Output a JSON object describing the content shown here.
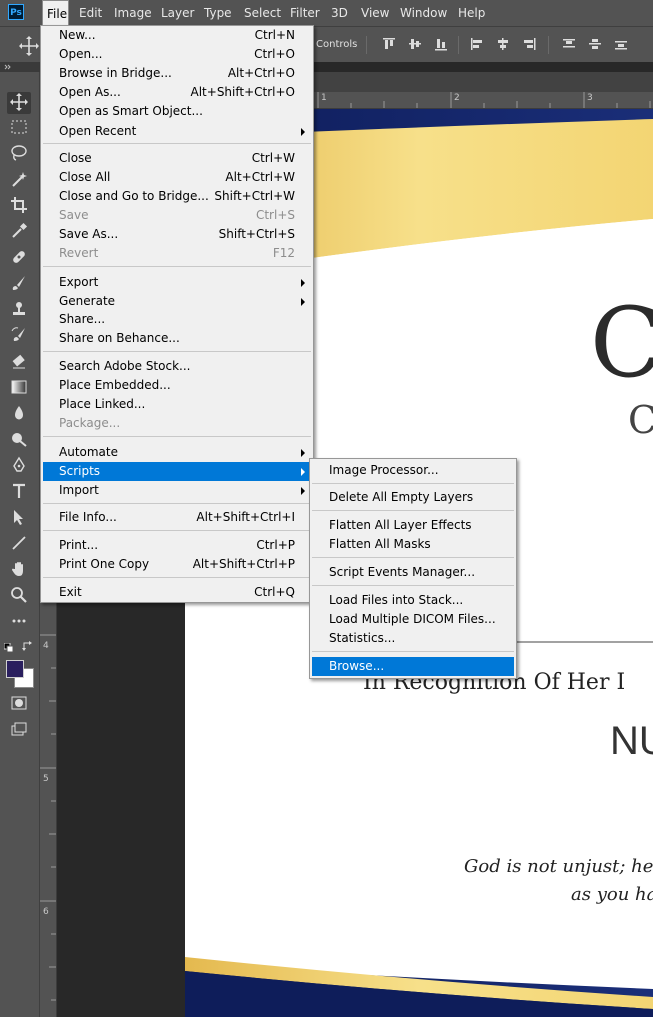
{
  "app": {
    "logo_text": "Ps"
  },
  "menubar": {
    "items": [
      {
        "label": "File"
      },
      {
        "label": "Edit"
      },
      {
        "label": "Image"
      },
      {
        "label": "Layer"
      },
      {
        "label": "Type"
      },
      {
        "label": "Select"
      },
      {
        "label": "Filter"
      },
      {
        "label": "3D"
      },
      {
        "label": "View"
      },
      {
        "label": "Window"
      },
      {
        "label": "Help"
      }
    ]
  },
  "options_bar": {
    "controls_label": "Controls"
  },
  "ruler": {
    "top_numbers": [
      "1",
      "2",
      "3"
    ],
    "left_numbers": [
      "4",
      "5",
      "6"
    ]
  },
  "file_menu": {
    "items": [
      {
        "label": "New...",
        "shortcut": "Ctrl+N"
      },
      {
        "label": "Open...",
        "shortcut": "Ctrl+O"
      },
      {
        "label": "Browse in Bridge...",
        "shortcut": "Alt+Ctrl+O"
      },
      {
        "label": "Open As...",
        "shortcut": "Alt+Shift+Ctrl+O"
      },
      {
        "label": "Open as Smart Object...",
        "shortcut": ""
      },
      {
        "label": "Open Recent",
        "shortcut": "",
        "submenu": true
      },
      {
        "label": "Close",
        "shortcut": "Ctrl+W"
      },
      {
        "label": "Close All",
        "shortcut": "Alt+Ctrl+W"
      },
      {
        "label": "Close and Go to Bridge...",
        "shortcut": "Shift+Ctrl+W"
      },
      {
        "label": "Save",
        "shortcut": "Ctrl+S",
        "disabled": true
      },
      {
        "label": "Save As...",
        "shortcut": "Shift+Ctrl+S"
      },
      {
        "label": "Revert",
        "shortcut": "F12",
        "disabled": true
      },
      {
        "label": "Export",
        "shortcut": "",
        "submenu": true
      },
      {
        "label": "Generate",
        "shortcut": "",
        "submenu": true
      },
      {
        "label": "Share...",
        "shortcut": ""
      },
      {
        "label": "Share on Behance...",
        "shortcut": ""
      },
      {
        "label": "Search Adobe Stock...",
        "shortcut": ""
      },
      {
        "label": "Place Embedded...",
        "shortcut": ""
      },
      {
        "label": "Place Linked...",
        "shortcut": ""
      },
      {
        "label": "Package...",
        "shortcut": "",
        "disabled": true
      },
      {
        "label": "Automate",
        "shortcut": "",
        "submenu": true
      },
      {
        "label": "Scripts",
        "shortcut": "",
        "submenu": true,
        "highlight": true
      },
      {
        "label": "Import",
        "shortcut": "",
        "submenu": true
      },
      {
        "label": "File Info...",
        "shortcut": "Alt+Shift+Ctrl+I"
      },
      {
        "label": "Print...",
        "shortcut": "Ctrl+P"
      },
      {
        "label": "Print One Copy",
        "shortcut": "Alt+Shift+Ctrl+P"
      },
      {
        "label": "Exit",
        "shortcut": "Ctrl+Q"
      }
    ]
  },
  "scripts_menu": {
    "items": [
      {
        "label": "Image Processor..."
      },
      {
        "label": "Delete All Empty Layers"
      },
      {
        "label": "Flatten All Layer Effects"
      },
      {
        "label": "Flatten All Masks"
      },
      {
        "label": "Script Events Manager..."
      },
      {
        "label": "Load Files into Stack..."
      },
      {
        "label": "Load Multiple DICOM Files..."
      },
      {
        "label": "Statistics..."
      },
      {
        "label": "Browse...",
        "highlight": true
      }
    ]
  },
  "document": {
    "big_letter": "C",
    "sub_letter": "C",
    "recognition": "In Recognition Of Her I",
    "name_fragment": "NU",
    "quote_line1": "God is not unjust; he w",
    "quote_line2": "as you ha"
  },
  "colors": {
    "foreground": "#2a1f5e",
    "background": "#ffffff",
    "highlight": "#0078d7"
  }
}
